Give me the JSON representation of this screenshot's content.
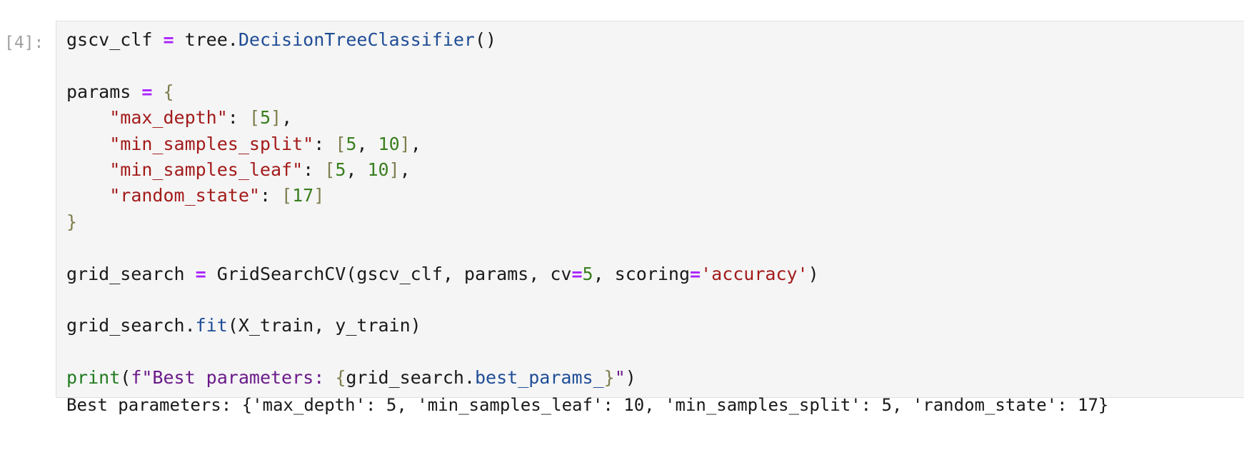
{
  "cell": {
    "prompt": "[4]:",
    "lines": [
      [
        {
          "t": "gscv_clf ",
          "c": ""
        },
        {
          "t": "=",
          "c": "op"
        },
        {
          "t": " tree.",
          "c": ""
        },
        {
          "t": "DecisionTreeClassifier",
          "c": "call"
        },
        {
          "t": "()",
          "c": ""
        }
      ],
      [],
      [
        {
          "t": "params ",
          "c": ""
        },
        {
          "t": "=",
          "c": "op"
        },
        {
          "t": " ",
          "c": ""
        },
        {
          "t": "{",
          "c": "brace"
        }
      ],
      [
        {
          "t": "    ",
          "c": ""
        },
        {
          "t": "\"max_depth\"",
          "c": "str"
        },
        {
          "t": ": ",
          "c": ""
        },
        {
          "t": "[",
          "c": "brace"
        },
        {
          "t": "5",
          "c": "num"
        },
        {
          "t": "]",
          "c": "brace"
        },
        {
          "t": ",",
          "c": ""
        }
      ],
      [
        {
          "t": "    ",
          "c": ""
        },
        {
          "t": "\"min_samples_split\"",
          "c": "str"
        },
        {
          "t": ": ",
          "c": ""
        },
        {
          "t": "[",
          "c": "brace"
        },
        {
          "t": "5",
          "c": "num"
        },
        {
          "t": ", ",
          "c": ""
        },
        {
          "t": "10",
          "c": "num"
        },
        {
          "t": "]",
          "c": "brace"
        },
        {
          "t": ",",
          "c": ""
        }
      ],
      [
        {
          "t": "    ",
          "c": ""
        },
        {
          "t": "\"min_samples_leaf\"",
          "c": "str"
        },
        {
          "t": ": ",
          "c": ""
        },
        {
          "t": "[",
          "c": "brace"
        },
        {
          "t": "5",
          "c": "num"
        },
        {
          "t": ", ",
          "c": ""
        },
        {
          "t": "10",
          "c": "num"
        },
        {
          "t": "]",
          "c": "brace"
        },
        {
          "t": ",",
          "c": ""
        }
      ],
      [
        {
          "t": "    ",
          "c": ""
        },
        {
          "t": "\"random_state\"",
          "c": "str"
        },
        {
          "t": ": ",
          "c": ""
        },
        {
          "t": "[",
          "c": "brace"
        },
        {
          "t": "17",
          "c": "num"
        },
        {
          "t": "]",
          "c": "brace"
        }
      ],
      [
        {
          "t": "}",
          "c": "brace"
        }
      ],
      [],
      [
        {
          "t": "grid_search ",
          "c": ""
        },
        {
          "t": "=",
          "c": "op"
        },
        {
          "t": " GridSearchCV(gscv_clf, params, cv",
          "c": ""
        },
        {
          "t": "=",
          "c": "op"
        },
        {
          "t": "5",
          "c": "num"
        },
        {
          "t": ", scoring",
          "c": ""
        },
        {
          "t": "=",
          "c": "op"
        },
        {
          "t": "'accuracy'",
          "c": "str"
        },
        {
          "t": ")",
          "c": ""
        }
      ],
      [],
      [
        {
          "t": "grid_search.",
          "c": ""
        },
        {
          "t": "fit",
          "c": "call"
        },
        {
          "t": "(X_train, y_train)",
          "c": ""
        }
      ],
      [],
      [
        {
          "t": "print",
          "c": "kw"
        },
        {
          "t": "(",
          "c": ""
        },
        {
          "t": "f\"Best parameters: ",
          "c": "fstr"
        },
        {
          "t": "{",
          "c": "brace"
        },
        {
          "t": "grid_search.",
          "c": ""
        },
        {
          "t": "best_params_",
          "c": "call"
        },
        {
          "t": "}",
          "c": "brace"
        },
        {
          "t": "\"",
          "c": "fstr"
        },
        {
          "t": ")",
          "c": ""
        }
      ]
    ],
    "output": "Best parameters: {'max_depth': 5, 'min_samples_leaf': 10, 'min_samples_split': 5, 'random_state': 17}"
  },
  "colors": {
    "input_background": "#f5f5f5",
    "prompt": "#a0a0a0",
    "operator": "#aa22ff",
    "call": "#1f4d96",
    "bracket": "#7e7e4e",
    "string": "#a31b1b",
    "number": "#3a7f1f",
    "builtin": "#217a21",
    "fstring": "#6b1a8a"
  }
}
